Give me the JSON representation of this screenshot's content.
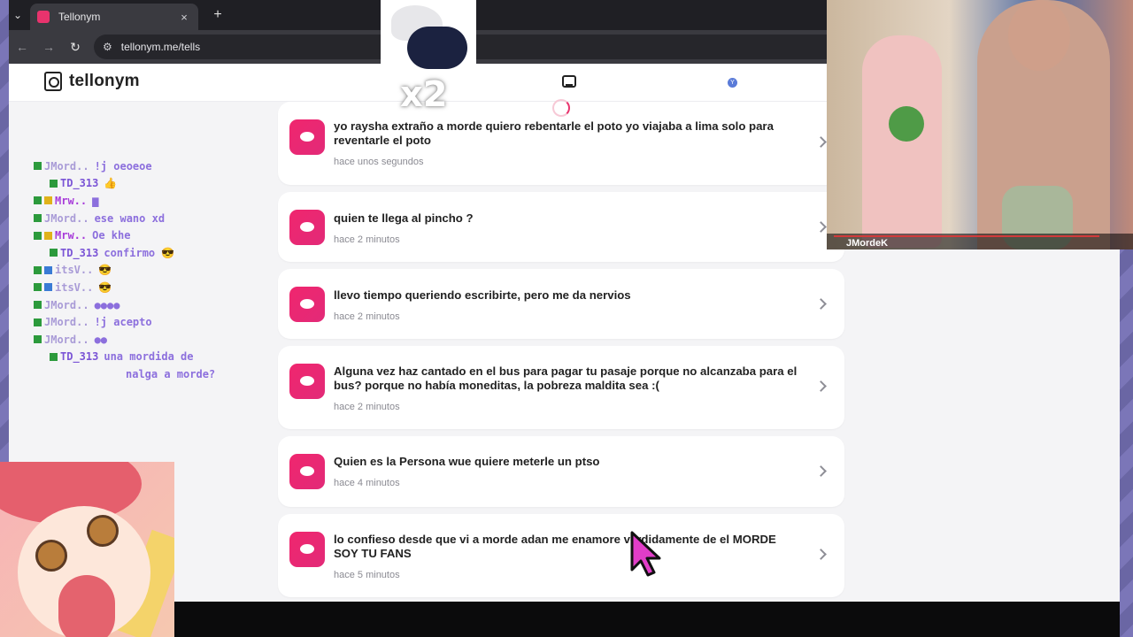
{
  "browser": {
    "tab_title": "Tellonym",
    "tab_close": "×",
    "new_tab": "+",
    "tab_menu": "⌄",
    "url": "tellonym.me/tells",
    "nav_back": "←",
    "nav_forward": "→",
    "nav_reload": "↻",
    "site_info": "⚙"
  },
  "header": {
    "logo_text": "tellonym",
    "avatar_initial": "Y"
  },
  "tells": [
    {
      "text": "yo raysha extraño a morde quiero rebentarle el poto yo viajaba a lima solo para reventarle el poto",
      "time": "hace unos segundos"
    },
    {
      "text": "quien te llega al pincho ?",
      "time": "hace 2 minutos"
    },
    {
      "text": "llevo tiempo queriendo escribirte, pero me da nervios",
      "time": "hace 2 minutos"
    },
    {
      "text": "Alguna vez haz cantado en el bus para pagar tu pasaje porque no alcanzaba para el bus? porque no había moneditas, la pobreza maldita sea :(",
      "time": "hace 2 minutos"
    },
    {
      "text": "Quien es la Persona wue quiere meterle un ptso",
      "time": "hace 4 minutos"
    },
    {
      "text": "lo confieso desde que vi a morde adan me enamore verdidamente de el MORDE SOY TU FANS",
      "time": "hace 5 minutos"
    }
  ],
  "chat": [
    {
      "name": "JMord..",
      "msg": "!j oeoeoe"
    },
    {
      "name": "TD_313",
      "msg": "👍"
    },
    {
      "name": "Mrw..",
      "msg": "▆"
    },
    {
      "name": "JMord..",
      "msg": "ese wano xd"
    },
    {
      "name": "Mrw..",
      "msg": "Oe khe"
    },
    {
      "name": "TD_313",
      "msg": "confirmo 😎"
    },
    {
      "name": "itsV..",
      "msg": "😎"
    },
    {
      "name": "itsV..",
      "msg": "😎"
    },
    {
      "name": "JMord..",
      "msg": "●●●●"
    },
    {
      "name": "JMord..",
      "msg": "!j acepto"
    },
    {
      "name": "JMord..",
      "msg": "●●"
    },
    {
      "name": "TD_313",
      "msg": "una mordida de"
    },
    {
      "name": "",
      "msg": "nalga a morde?"
    }
  ],
  "webcam": {
    "channel": "JMordeK"
  },
  "sticker": {
    "label": "x2"
  },
  "colors": {
    "accent": "#e8336d",
    "chat_purple": "#8c6fdd"
  }
}
